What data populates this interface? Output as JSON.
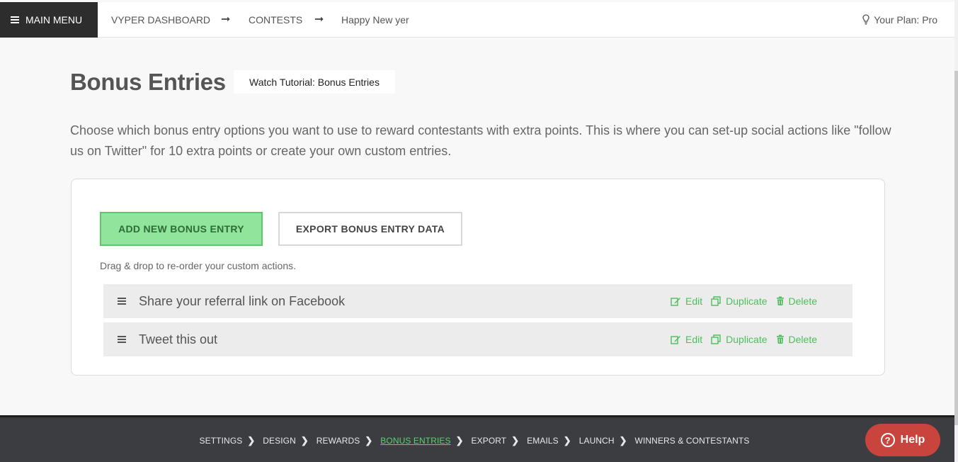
{
  "topbar": {
    "main_menu_label": "MAIN MENU",
    "breadcrumb": [
      "VYPER DASHBOARD",
      "CONTESTS",
      "Happy New yer"
    ],
    "arrow": "➞",
    "plan_label": "Your Plan: Pro"
  },
  "page": {
    "title": "Bonus Entries",
    "tutorial_button": "Watch Tutorial: Bonus Entries",
    "intro": "Choose which bonus entry options you want to use to reward contestants with extra points. This is where you can set-up social actions like \"follow us on Twitter\" for 10 extra points or create your own custom entries."
  },
  "card": {
    "add_button": "ADD NEW BONUS ENTRY",
    "export_button": "EXPORT BONUS ENTRY DATA",
    "hint": "Drag & drop to re-order your custom actions.",
    "entries": [
      {
        "title": "Share your referral link on Facebook",
        "edit": "Edit",
        "duplicate": "Duplicate",
        "delete": "Delete"
      },
      {
        "title": "Tweet this out",
        "edit": "Edit",
        "duplicate": "Duplicate",
        "delete": "Delete"
      }
    ]
  },
  "footer": {
    "steps": [
      "SETTINGS",
      "DESIGN",
      "REWARDS",
      "BONUS ENTRIES",
      "EXPORT",
      "EMAILS",
      "LAUNCH",
      "WINNERS & CONTESTANTS"
    ],
    "active_step": "BONUS ENTRIES",
    "help_label": "Help",
    "help_icon_glyph": "?"
  },
  "colors": {
    "accent_green": "#4cbf5c",
    "add_button_bg": "#90e49c",
    "help_red": "#c9443d",
    "footer_bg": "#3c3d41",
    "menu_bg": "#2d2d2d"
  },
  "icons": [
    "hamburger-icon",
    "arrow-right-icon",
    "lightbulb-icon",
    "drag-handle-icon",
    "edit-icon",
    "duplicate-icon",
    "trash-icon",
    "chevron-right-icon",
    "question-circle-icon"
  ]
}
